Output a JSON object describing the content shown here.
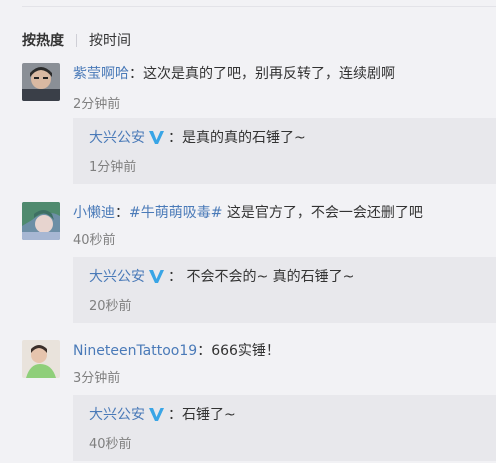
{
  "sort": {
    "hot": "按热度",
    "time": "按时间"
  },
  "comments": [
    {
      "user": "紫莹啊哈",
      "sep": "：",
      "text": "这次是真的了吧，别再反转了，连续剧啊",
      "time": "2分钟前",
      "reply": {
        "user": "大兴公安",
        "text": "：是真的真的石锤了~",
        "time": "1分钟前"
      }
    },
    {
      "user": "小懒迪",
      "sep": "：",
      "topic": "#牛萌萌吸毒#",
      "text": " 这是官方了，不会一会还删了吧",
      "time": "40秒前",
      "reply": {
        "user": "大兴公安",
        "text": "： 不会不会的~ 真的石锤了~",
        "time": "20秒前"
      }
    },
    {
      "user": "NineteenTattoo19",
      "sep": "：",
      "text": "666实锤！",
      "time": "3分钟前",
      "reply": {
        "user": "大兴公安",
        "text": "：石锤了~",
        "time": "40秒前"
      }
    }
  ],
  "colors": {
    "link": "#4a7ab8",
    "badge": "#39a5e6",
    "background": "#f2f2f5",
    "reply_background": "#e8e8ec"
  },
  "icons": {
    "verified": "verified-v-icon"
  }
}
